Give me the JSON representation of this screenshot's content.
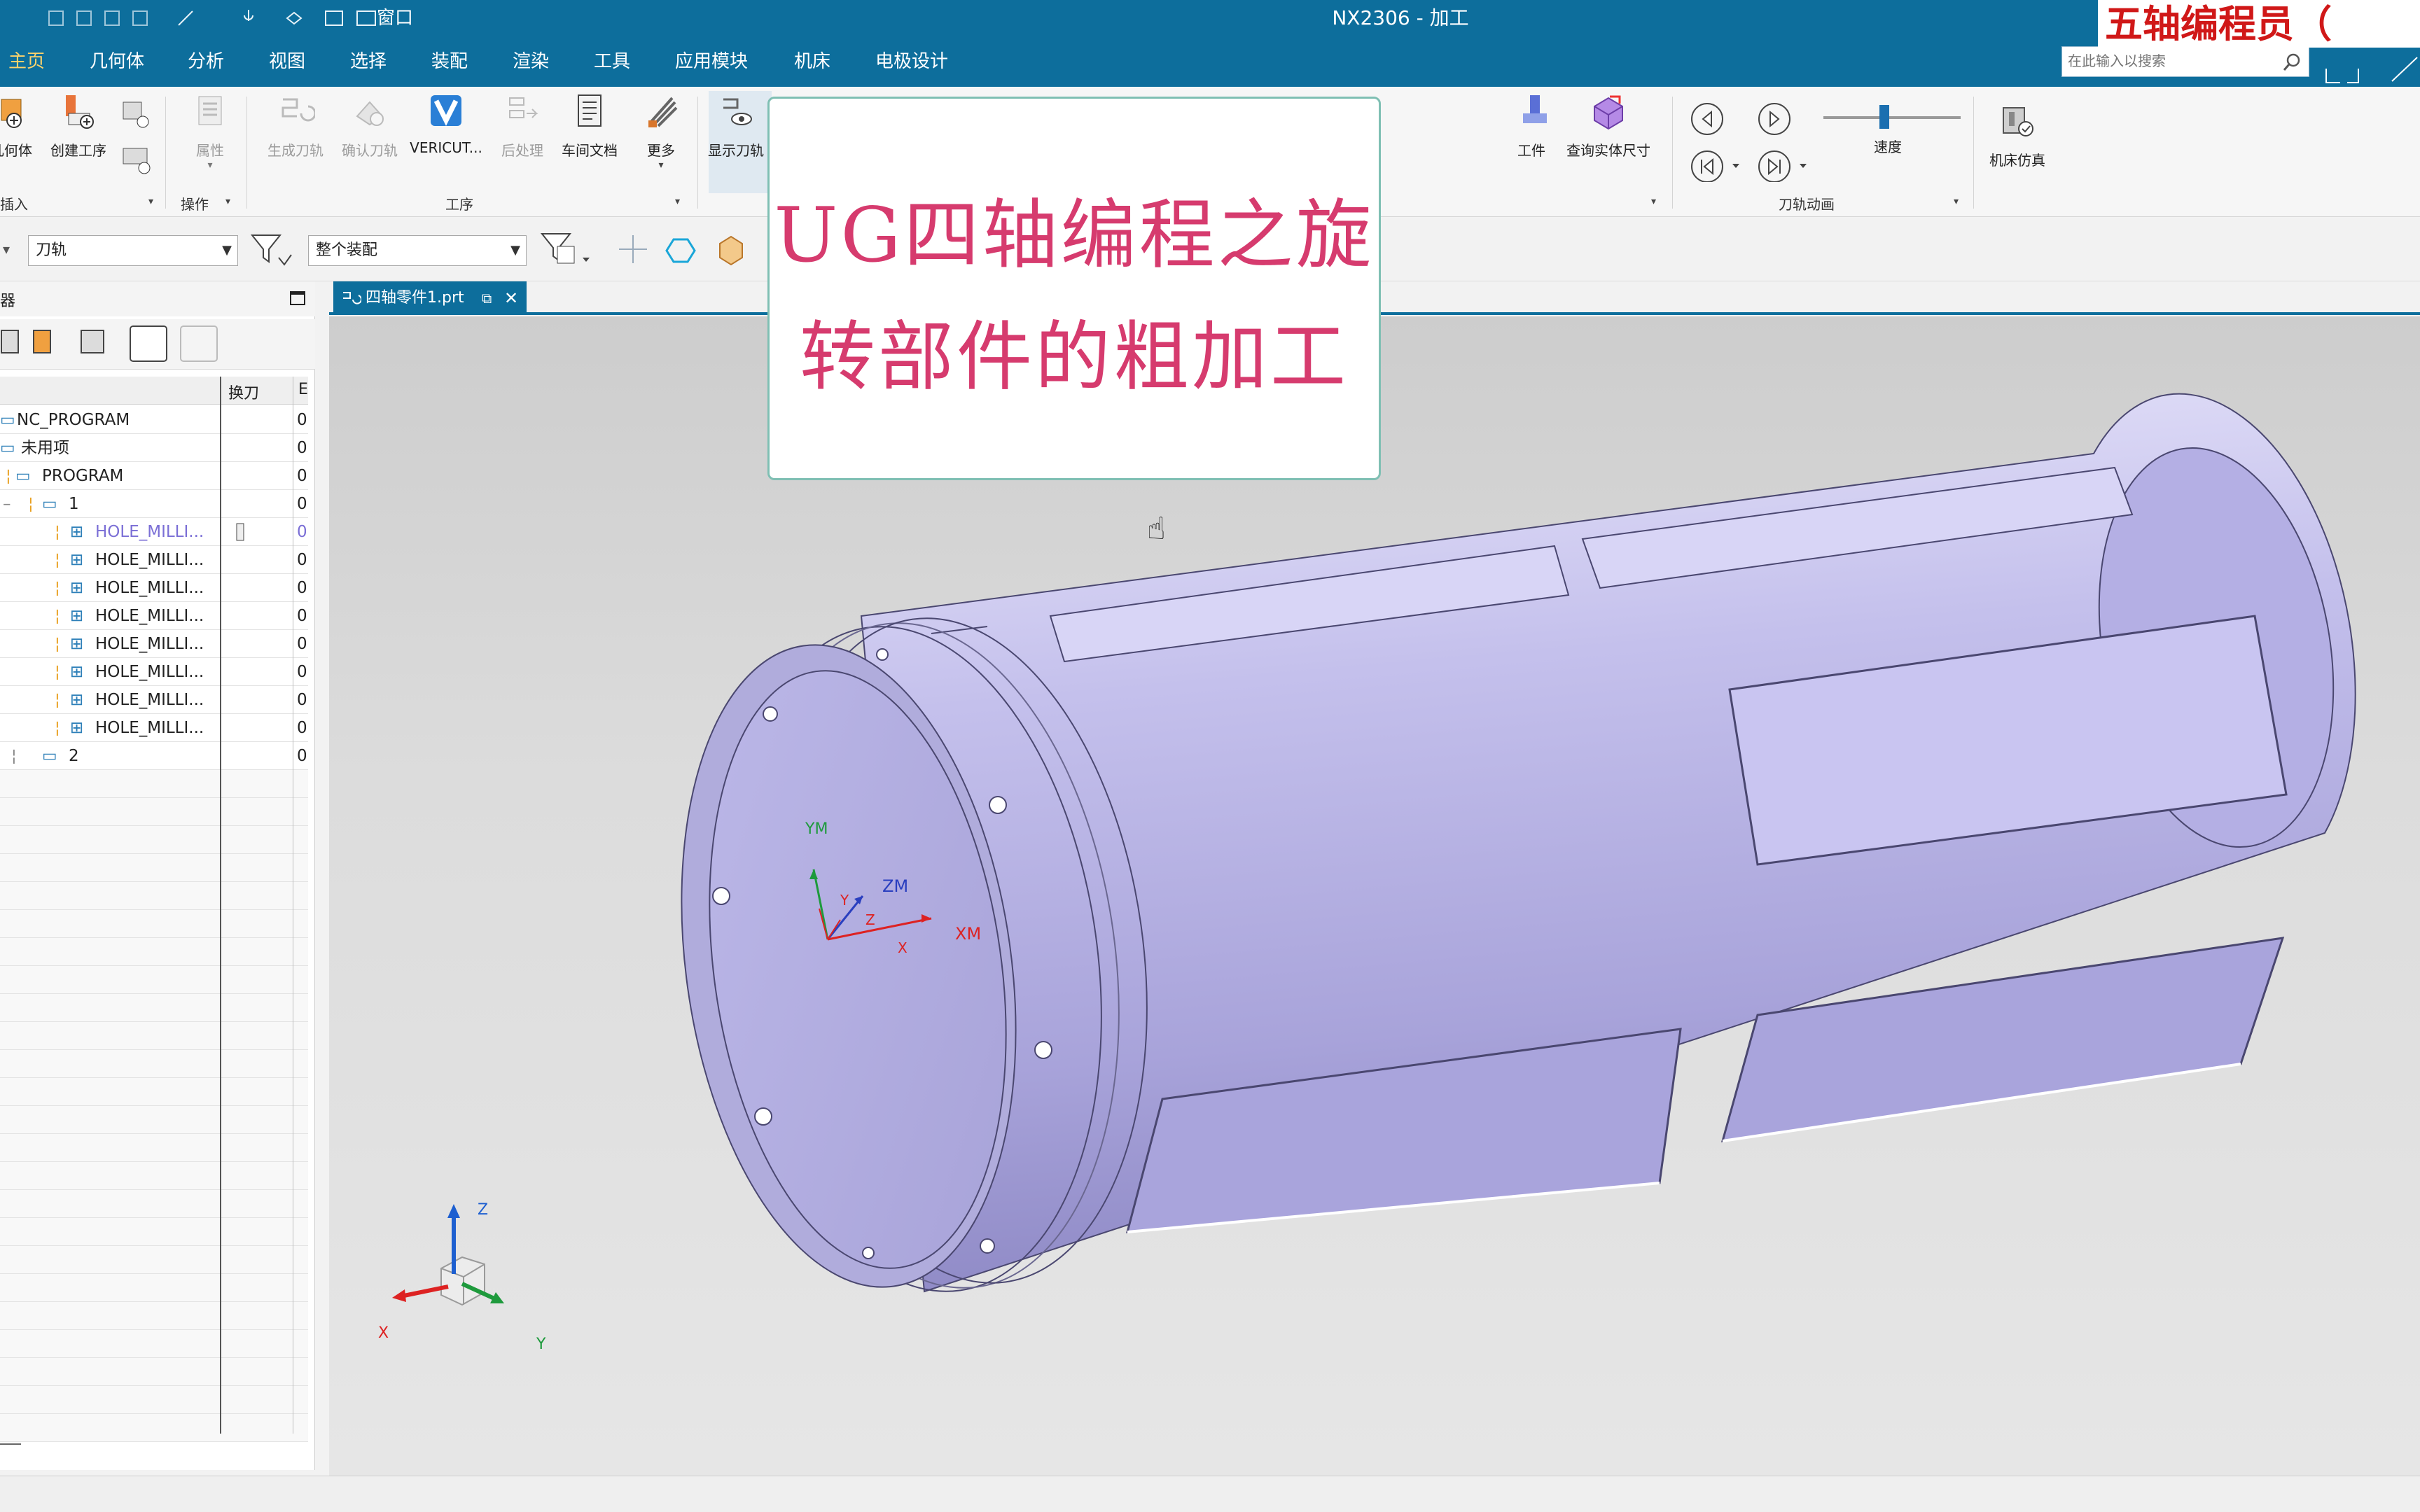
{
  "window": {
    "title": "NX2306 - 加工"
  },
  "quick_access": {
    "window_label": "窗口"
  },
  "menu": {
    "items": [
      "主页",
      "几何体",
      "分析",
      "视图",
      "选择",
      "装配",
      "渲染",
      "工具",
      "应用模块",
      "机床",
      "电极设计"
    ],
    "active": "主页"
  },
  "search": {
    "placeholder": "在此输入以搜索"
  },
  "banner": {
    "text": "五轴编程员（"
  },
  "ribbon": {
    "insert_group": {
      "buttons": [
        "几何体",
        "创建工序"
      ],
      "label": "插入"
    },
    "operation_group": {
      "buttons": [
        "属性"
      ],
      "label": "操作"
    },
    "process_group": {
      "buttons": [
        "生成刀轨",
        "确认刀轨",
        "VERICUT...",
        "后处理",
        "车间文档",
        "更多"
      ],
      "label": "工序"
    },
    "display_group": {
      "buttons": [
        "显示刀轨"
      ]
    },
    "workpiece_group": {
      "buttons": [
        "工件",
        "查询实体尺寸"
      ]
    },
    "animation_group": {
      "speed_label": "速度",
      "label": "刀轨动画"
    },
    "machine_sim": {
      "label": "机床仿真"
    }
  },
  "filterbar": {
    "type_filter": "刀轨",
    "scope_filter": "整个装配"
  },
  "navigator": {
    "title_fragment": "器",
    "column_tool_change": "换刀",
    "column_third_fragment": "E",
    "rows": [
      {
        "label": "NC_PROGRAM",
        "value": "0"
      },
      {
        "label": "未用项",
        "value": "0"
      },
      {
        "label": "PROGRAM",
        "value": "0"
      },
      {
        "label": "1",
        "value": "0"
      },
      {
        "label": "HOLE_MILLI...",
        "value": "0"
      },
      {
        "label": "HOLE_MILLI...",
        "value": "0"
      },
      {
        "label": "HOLE_MILLI...",
        "value": "0"
      },
      {
        "label": "HOLE_MILLI...",
        "value": "0"
      },
      {
        "label": "HOLE_MILLI...",
        "value": "0"
      },
      {
        "label": "HOLE_MILLI...",
        "value": "0"
      },
      {
        "label": "HOLE_MILLI...",
        "value": "0"
      },
      {
        "label": "HOLE_MILLI...",
        "value": "0"
      },
      {
        "label": "2",
        "value": "0"
      }
    ]
  },
  "document_tab": {
    "label": "四轴零件1.prt"
  },
  "overlay": {
    "line1": "UG四轴编程之旋",
    "line2": "转部件的粗加工"
  },
  "csys": {
    "ym": "YM",
    "zm": "ZM",
    "xm": "XM",
    "y": "Y",
    "z": "Z",
    "x": "X"
  },
  "triad": {
    "x": "X",
    "y": "Y",
    "z": "Z"
  },
  "colors": {
    "titlebar": "#0d6e9c",
    "part": "#b7b2e4",
    "overlay_text": "#d63b6e",
    "banner_text": "#d01818"
  }
}
